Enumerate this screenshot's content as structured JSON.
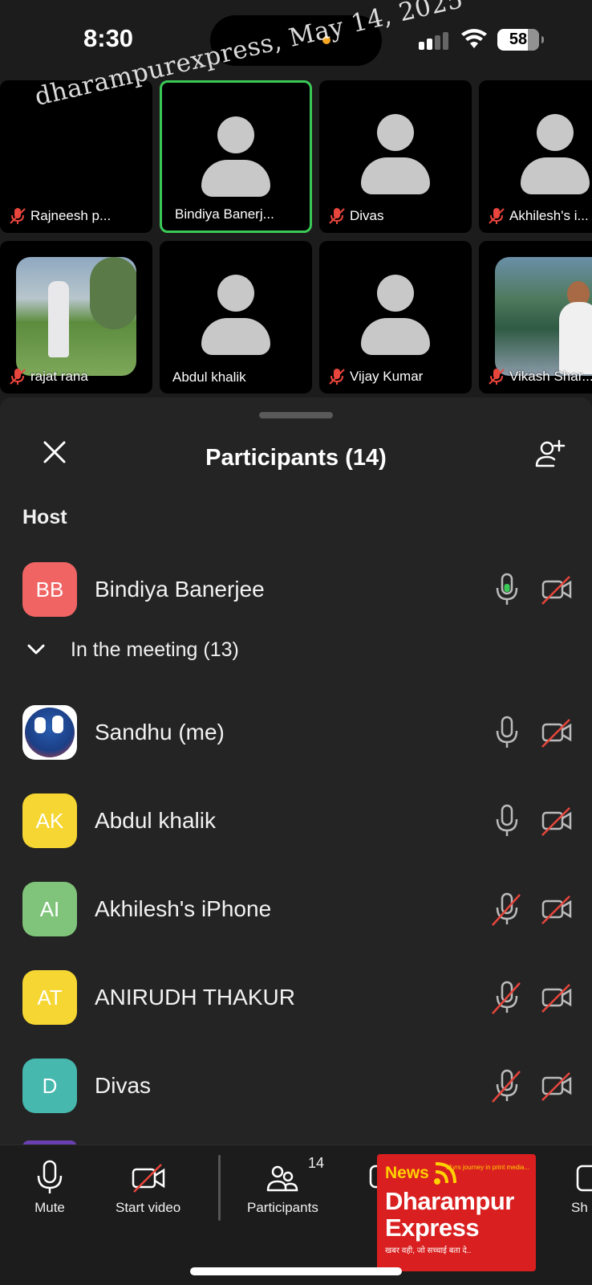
{
  "status_bar": {
    "time": "8:30",
    "battery": "58"
  },
  "watermark": "dharampurexpress, May 14, 2025",
  "video_tiles": [
    {
      "name": "Rajneesh p...",
      "muted": true
    },
    {
      "name": "Bindiya Banerj...",
      "muted": false,
      "active": true
    },
    {
      "name": "Divas",
      "muted": true
    },
    {
      "name": "Akhilesh's i...",
      "muted": true
    },
    {
      "name": "rajat rana",
      "muted": true,
      "photo": true
    },
    {
      "name": "Abdul khalik",
      "muted": false
    },
    {
      "name": "Vijay Kumar",
      "muted": true
    },
    {
      "name": "Vikash Shar...",
      "muted": true,
      "photo": true
    }
  ],
  "panel": {
    "title": "Participants (14)",
    "host_label": "Host",
    "meeting_label": "In the meeting (13)"
  },
  "host": {
    "initials": "BB",
    "name": "Bindiya Banerjee",
    "color": "#f06464",
    "mic": "on-active",
    "video": "off"
  },
  "participants": [
    {
      "initials": "",
      "name": "Sandhu (me)",
      "color": "#ffffff",
      "mic": "on",
      "video": "off",
      "logo": true
    },
    {
      "initials": "AK",
      "name": "Abdul khalik",
      "color": "#f5d632",
      "mic": "on",
      "video": "off"
    },
    {
      "initials": "AI",
      "name": "Akhilesh's iPhone",
      "color": "#7fc47a",
      "mic": "off",
      "video": "off"
    },
    {
      "initials": "AT",
      "name": "ANIRUDH THAKUR",
      "color": "#f5d632",
      "mic": "off",
      "video": "off"
    },
    {
      "initials": "D",
      "name": "Divas",
      "color": "#46b8ad",
      "mic": "off",
      "video": "off"
    }
  ],
  "toolbar": {
    "mute": "Mute",
    "start_video": "Start video",
    "participants": "Participants",
    "participants_count": "14",
    "chat_partial": "C",
    "share_partial": "Sh"
  },
  "ad": {
    "news": "News",
    "tag": "11yrs journey in print media...",
    "line1": "Dharampur",
    "line2": "Express",
    "sub": "खबर वही, जो सच्चाई बता दे.."
  }
}
